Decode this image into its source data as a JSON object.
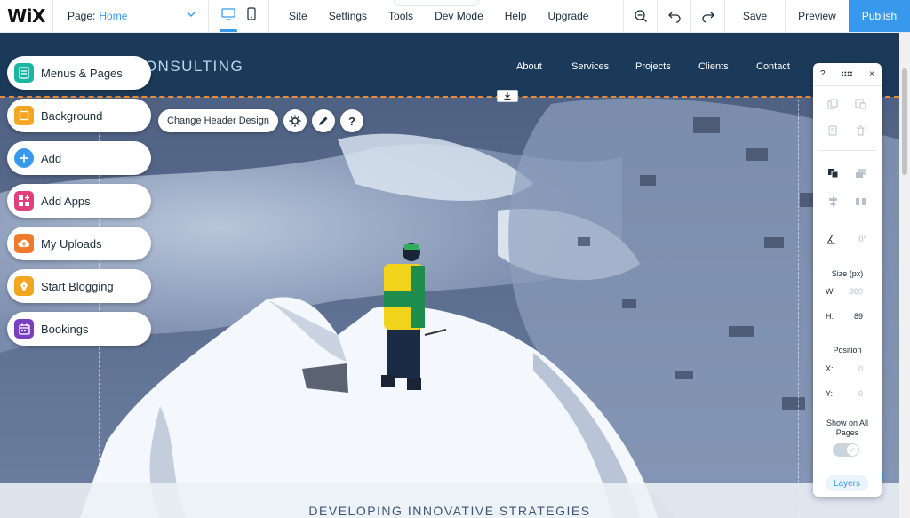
{
  "topbar": {
    "logo": "WiX",
    "page_label": "Page:",
    "page_current": "Home",
    "menu": [
      "Site",
      "Settings",
      "Tools",
      "Dev Mode",
      "Help",
      "Upgrade"
    ],
    "save": "Save",
    "preview": "Preview",
    "publish": "Publish"
  },
  "site": {
    "name": "S CONSULTING",
    "nav": [
      "About",
      "Services",
      "Projects",
      "Clients",
      "Contact"
    ],
    "tagline": "DEVELOPING INNOVATIVE STRATEGIES"
  },
  "left_panel": [
    {
      "label": "Menus & Pages",
      "icon": "pages-icon",
      "color": "#1ab7a4"
    },
    {
      "label": "Background",
      "icon": "background-icon",
      "color": "#f5a623"
    },
    {
      "label": "Add",
      "icon": "plus-icon",
      "color": "#3899ec"
    },
    {
      "label": "Add Apps",
      "icon": "apps-icon",
      "color": "#e0417d"
    },
    {
      "label": "My Uploads",
      "icon": "upload-icon",
      "color": "#f07b2a"
    },
    {
      "label": "Start Blogging",
      "icon": "pen-nib-icon",
      "color": "#f2a51f"
    },
    {
      "label": "Bookings",
      "icon": "calendar-icon",
      "color": "#7a3fbf"
    }
  ],
  "context_toolbar": {
    "main": "Change Header Design",
    "settings_icon": "gear-icon",
    "design_icon": "pencil-icon",
    "help_label": "?"
  },
  "right_panel": {
    "help": "?",
    "close": "×",
    "rotation_value": "0°",
    "size_title": "Size (px)",
    "w_label": "W:",
    "w_value": "980",
    "h_label": "H:",
    "h_value": "89",
    "position_title": "Position",
    "x_label": "X:",
    "x_value": "0",
    "y_label": "Y:",
    "y_value": "0",
    "show_on_all": "Show on All Pages",
    "layers": "Layers"
  },
  "colors": {
    "accent": "#3899ec",
    "header_bg": "#1b3a5a",
    "selection_border": "#e78a3a"
  }
}
